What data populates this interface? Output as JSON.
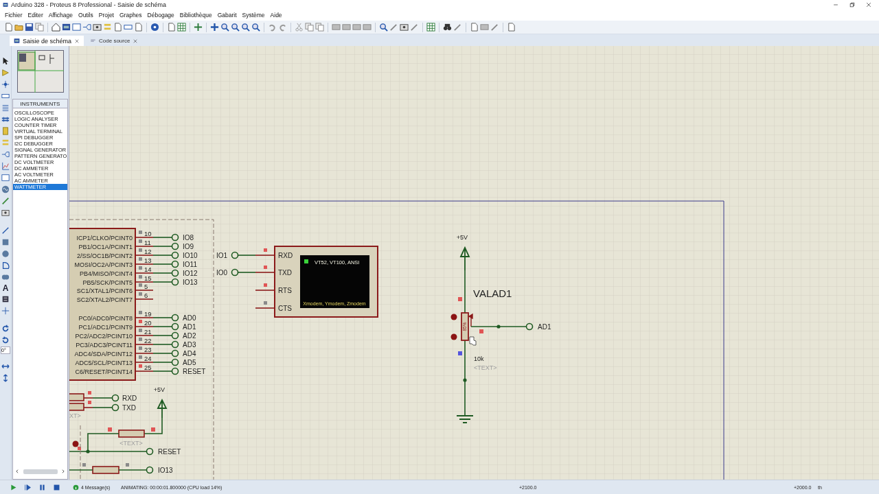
{
  "window": {
    "title": "Arduino 328 - Proteus 8 Professional - Saisie de schéma"
  },
  "menu": [
    "Fichier",
    "Editer",
    "Affichage",
    "Outils",
    "Projet",
    "Graphes",
    "Débogage",
    "Bibliothèque",
    "Gabarit",
    "Système",
    "Aide"
  ],
  "tabs": [
    {
      "label": "Saisie de schéma",
      "selected": true
    },
    {
      "label": "Code source",
      "selected": false
    }
  ],
  "tool_strip": {
    "text_glyph": "A",
    "angle": "0°"
  },
  "panel": {
    "header": "INSTRUMENTS",
    "items": [
      {
        "label": "OSCILLOSCOPE",
        "selected": false
      },
      {
        "label": "LOGIC ANALYSER",
        "selected": false
      },
      {
        "label": "COUNTER TIMER",
        "selected": false
      },
      {
        "label": "VIRTUAL TERMINAL",
        "selected": false
      },
      {
        "label": "SPI DEBUGGER",
        "selected": false
      },
      {
        "label": "I2C DEBUGGER",
        "selected": false
      },
      {
        "label": "SIGNAL GENERATOR",
        "selected": false
      },
      {
        "label": "PATTERN GENERATO",
        "selected": false
      },
      {
        "label": "DC VOLTMETER",
        "selected": false
      },
      {
        "label": "DC AMMETER",
        "selected": false
      },
      {
        "label": "AC VOLTMETER",
        "selected": false
      },
      {
        "label": "AC AMMETER",
        "selected": false
      },
      {
        "label": "WATTMETER",
        "selected": true
      }
    ]
  },
  "schematic": {
    "mcu": {
      "port_b": [
        {
          "label": "ICP1/CLKO/PCINT0",
          "number": "10",
          "net": "IO8",
          "color": "#8a8a8a"
        },
        {
          "label": "PB1/OC1A/PCINT1",
          "number": "11",
          "net": "IO9",
          "color": "#8a8a8a"
        },
        {
          "label": "2/SS/OC1B/PCINT2",
          "number": "12",
          "net": "IO10",
          "color": "#8a8a8a"
        },
        {
          "label": "MOSI/OC2A/PCINT3",
          "number": "13",
          "net": "IO11",
          "color": "#8a8a8a"
        },
        {
          "label": "PB4/MISO/PCINT4",
          "number": "14",
          "net": "IO12",
          "color": "#8a8a8a"
        },
        {
          "label": "PB5/SCK/PCINT5",
          "number": "15",
          "net": "IO13",
          "color": "#8a8a8a"
        },
        {
          "label": "SC1/XTAL1/PCINT6",
          "number": "5",
          "color": "#8a8a8a"
        },
        {
          "label": "SC2/XTAL2/PCINT7",
          "number": "6",
          "color": "#8a8a8a"
        }
      ],
      "port_c": [
        {
          "label": "PC0/ADC0/PCINT8",
          "number": "19",
          "net": "AD0",
          "color": "#8a8a8a"
        },
        {
          "label": "PC1/ADC1/PCINT9",
          "number": "20",
          "net": "AD1",
          "color": "#e05555"
        },
        {
          "label": "PC2/ADC2/PCINT10",
          "number": "21",
          "net": "AD2",
          "color": "#8a8a8a"
        },
        {
          "label": "PC3/ADC3/PCINT11",
          "number": "22",
          "net": "AD3",
          "color": "#8a8a8a"
        },
        {
          "label": "ADC4/SDA/PCINT12",
          "number": "23",
          "net": "AD4",
          "color": "#8a8a8a"
        },
        {
          "label": "ADC5/SCL/PCINT13",
          "number": "24",
          "net": "AD5",
          "color": "#8a8a8a"
        },
        {
          "label": "C6/RESET/PCINT14",
          "number": "25",
          "net": "RESET",
          "color": "#e05555"
        }
      ]
    },
    "terminal": {
      "pins": [
        {
          "label": "RXD",
          "net": "IO1",
          "color": "#e05555"
        },
        {
          "label": "TXD",
          "net": "IO0",
          "color": "#e05555"
        },
        {
          "label": "RTS",
          "color": "#e05555"
        },
        {
          "label": "CTS",
          "color": "#8a8a8a"
        }
      ],
      "screen_lines": [
        "VT52, VT100, ANSI",
        "Xmodem, Ymodem, Zmodem"
      ]
    },
    "pot": {
      "supply": "+5V",
      "name": "VALAD1",
      "reading": "85%",
      "value": "10k",
      "text": "<TEXT>",
      "net": "AD1"
    },
    "lower_left": {
      "terminals": [
        "RXD",
        "TXD"
      ],
      "cut_text": "XT>",
      "supply": "+5V",
      "resistor_text": "<TEXT>",
      "reset_net": "RESET",
      "io_net": "IO13"
    }
  },
  "status_bar": {
    "messages": "4 Message(s)",
    "animation": "ANIMATING: 00:00:01.800000 (CPU load 14%)",
    "x": "+2100.0",
    "y": "+2000.0",
    "unit": "th"
  }
}
